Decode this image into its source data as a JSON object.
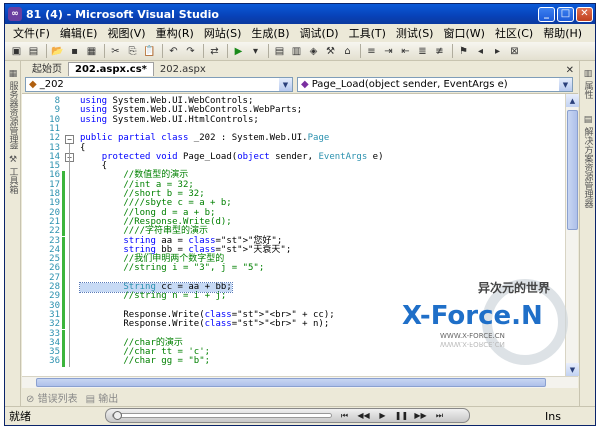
{
  "window": {
    "title": "81 (4) - Microsoft Visual Studio"
  },
  "menu": [
    "文件(F)",
    "编辑(E)",
    "视图(V)",
    "重构(R)",
    "网站(S)",
    "生成(B)",
    "调试(D)",
    "工具(T)",
    "测试(S)",
    "窗口(W)",
    "社区(C)",
    "帮助(H)"
  ],
  "tabs": [
    "起始页",
    "202.aspx.cs*",
    "202.aspx"
  ],
  "nav": {
    "class_combo": "_202",
    "method_combo": "Page_Load(object sender, EventArgs e)"
  },
  "left_panel": [
    "服务器资源管理器",
    "工具箱"
  ],
  "right_panel": [
    "属性",
    "解决方案资源管理器"
  ],
  "code_lines": [
    {
      "n": "8",
      "t": "using System.Web.UI.WebControls;"
    },
    {
      "n": "9",
      "t": "using System.Web.UI.WebControls.WebParts;"
    },
    {
      "n": "10",
      "t": "using System.Web.UI.HtmlControls;"
    },
    {
      "n": "11",
      "t": ""
    },
    {
      "n": "12",
      "t": "public partial class _202 : System.Web.UI.Page"
    },
    {
      "n": "13",
      "t": "{"
    },
    {
      "n": "14",
      "t": "    protected void Page_Load(object sender, EventArgs e)"
    },
    {
      "n": "15",
      "t": "    {"
    },
    {
      "n": "16",
      "t": "        //数值型的演示"
    },
    {
      "n": "17",
      "t": "        //int a = 32;"
    },
    {
      "n": "18",
      "t": "        //short b = 32;"
    },
    {
      "n": "19",
      "t": "        ////sbyte c = a + b;"
    },
    {
      "n": "20",
      "t": "        //long d = a + b;"
    },
    {
      "n": "21",
      "t": "        //Response.Write(d);"
    },
    {
      "n": "22",
      "t": "        ////字符串型的演示"
    },
    {
      "n": "23",
      "t": "        string aa = \"您好\";"
    },
    {
      "n": "24",
      "t": "        string bb = \"天衰天\";"
    },
    {
      "n": "25",
      "t": "        //我们申明两个数字型的"
    },
    {
      "n": "26",
      "t": "        //string i = \"3\", j = \"5\";"
    },
    {
      "n": "27",
      "t": ""
    },
    {
      "n": "28",
      "t": "        String cc = aa + bb;"
    },
    {
      "n": "29",
      "t": "        //string n = i + j;"
    },
    {
      "n": "30",
      "t": ""
    },
    {
      "n": "31",
      "t": "        Response.Write(\"<br>\" + cc);"
    },
    {
      "n": "32",
      "t": "        Response.Write(\"<br>\" + n);"
    },
    {
      "n": "33",
      "t": ""
    },
    {
      "n": "34",
      "t": "        //char的演示"
    },
    {
      "n": "35",
      "t": "        //char tt = 'c';"
    },
    {
      "n": "36",
      "t": "        //char gg = \"b\";"
    }
  ],
  "bottom_tabs": [
    "错误列表",
    "输出"
  ],
  "status": {
    "ready": "就绪",
    "mode": "Ins"
  },
  "watermark": {
    "brand": "X-Force.N",
    "cn": "异次元的世界",
    "url": "WWW.X-FORCE.CN"
  },
  "colors": {
    "title_bar": "#0a5ad8",
    "keyword": "#0000ff",
    "comment": "#008000",
    "string": "#a31515",
    "type": "#2b91af",
    "selection": "#c7daf5"
  }
}
